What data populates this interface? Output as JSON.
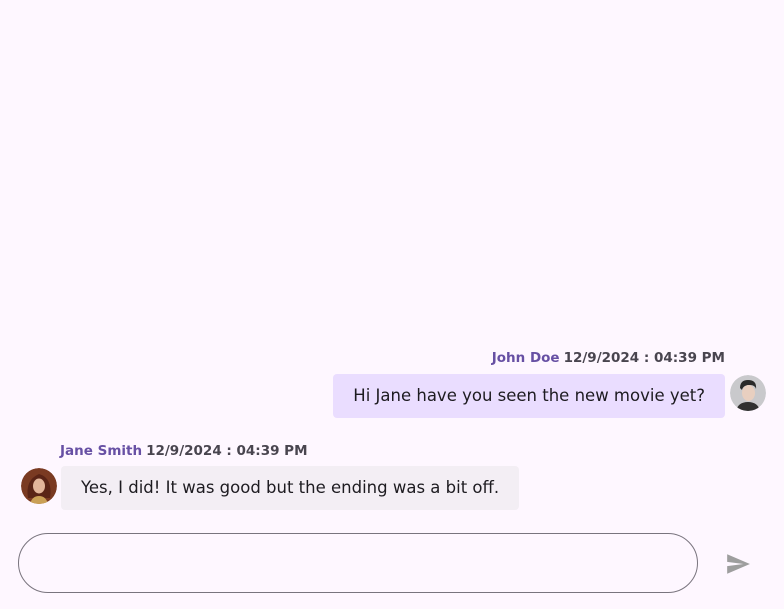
{
  "messages": [
    {
      "author": "John Doe",
      "time": "12/9/2024 : 04:39 PM",
      "text": "Hi Jane have you seen the new movie yet?",
      "direction": "outgoing"
    },
    {
      "author": "Jane Smith",
      "time": "12/9/2024 : 04:39 PM",
      "text": "Yes, I did! It was good but the ending was a bit off.",
      "direction": "incoming"
    }
  ],
  "composer": {
    "placeholder": "",
    "value": ""
  },
  "icons": {
    "send": "send-icon"
  },
  "colors": {
    "background": "#fef7ff",
    "outgoing_bubble": "#eaddff",
    "incoming_bubble": "#f3eef4",
    "author_name": "#6750a4",
    "send_icon": "#9e9e9e"
  }
}
